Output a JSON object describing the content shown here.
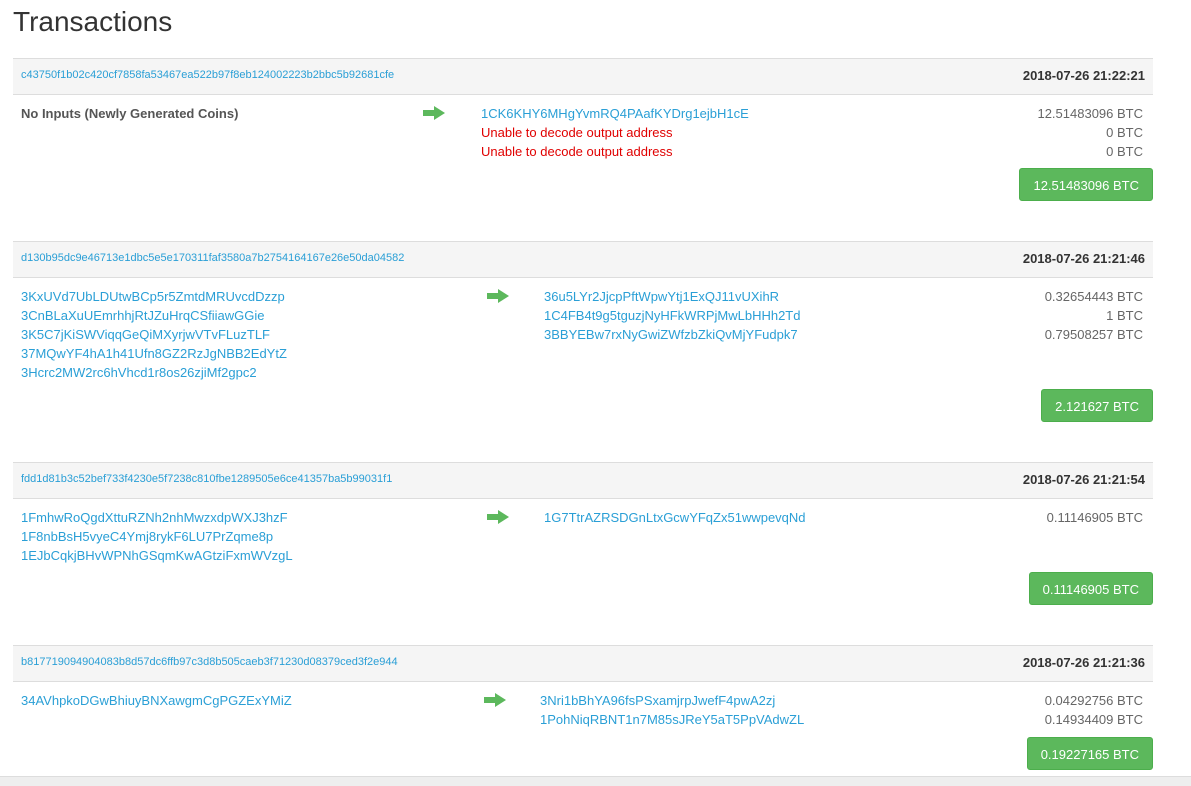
{
  "page": {
    "title": "Transactions"
  },
  "colors": {
    "link": "#2a9fd6",
    "error": "#e00000",
    "total_bg": "#5cb85c",
    "arrow": "#5cb85c"
  },
  "transactions": [
    {
      "hash": "c43750f1b02c420cf7858fa53467ea522b97f8eb124002223b2bbc5b92681cfe",
      "time": "2018-07-26 21:22:21",
      "no_inputs_label": "No Inputs (Newly Generated Coins)",
      "inputs": [],
      "outputs": [
        {
          "address": "1CK6KHY6MHgYvmRQ4PAafKYDrg1ejbH1cE",
          "amount": "12.51483096 BTC"
        },
        {
          "address": "Unable to decode output address",
          "amount": "0 BTC",
          "error": true
        },
        {
          "address": "Unable to decode output address",
          "amount": "0 BTC",
          "error": true
        }
      ],
      "total": "12.51483096 BTC"
    },
    {
      "hash": "d130b95dc9e46713e1dbc5e5e170311faf3580a7b2754164167e26e50da04582",
      "time": "2018-07-26 21:21:46",
      "inputs": [
        "3KxUVd7UbLDUtwBCp5r5ZmtdMRUvcdDzzp",
        "3CnBLaXuUEmrhhjRtJZuHrqCSfiiawGGie",
        "3K5C7jKiSWViqqGeQiMXyrjwVTvFLuzTLF",
        "37MQwYF4hA1h41Ufn8GZ2RzJgNBB2EdYtZ",
        "3Hcrc2MW2rc6hVhcd1r8os26zjiMf2gpc2"
      ],
      "outputs": [
        {
          "address": "36u5LYr2JjcpPftWpwYtj1ExQJ11vUXihR",
          "amount": "0.32654443 BTC"
        },
        {
          "address": "1C4FB4t9g5tguzjNyHFkWRPjMwLbHHh2Td",
          "amount": "1 BTC"
        },
        {
          "address": "3BBYEBw7rxNyGwiZWfzbZkiQvMjYFudpk7",
          "amount": "0.79508257 BTC"
        }
      ],
      "total": "2.121627 BTC"
    },
    {
      "hash": "fdd1d81b3c52bef733f4230e5f7238c810fbe1289505e6ce41357ba5b99031f1",
      "time": "2018-07-26 21:21:54",
      "inputs": [
        "1FmhwRoQgdXttuRZNh2nhMwzxdpWXJ3hzF",
        "1F8nbBsH5vyeC4Ymj8rykF6LU7PrZqme8p",
        "1EJbCqkjBHvWPNhGSqmKwAGtziFxmWVzgL"
      ],
      "outputs": [
        {
          "address": "1G7TtrAZRSDGnLtxGcwYFqZx51wwpevqNd",
          "amount": "0.11146905 BTC"
        }
      ],
      "total": "0.11146905 BTC"
    },
    {
      "hash": "b817719094904083b8d57dc6ffb97c3d8b505caeb3f71230d08379ced3f2e944",
      "time": "2018-07-26 21:21:36",
      "inputs": [
        "34AVhpkoDGwBhiuyBNXawgmCgPGZExYMiZ"
      ],
      "outputs": [
        {
          "address": "3Nri1bBhYA96fsPSxamjrpJwefF4pwA2zj",
          "amount": "0.04292756 BTC"
        },
        {
          "address": "1PohNiqRBNT1n7M85sJReY5aT5PpVAdwZL",
          "amount": "0.14934409 BTC"
        }
      ],
      "total": "0.19227165 BTC"
    }
  ]
}
